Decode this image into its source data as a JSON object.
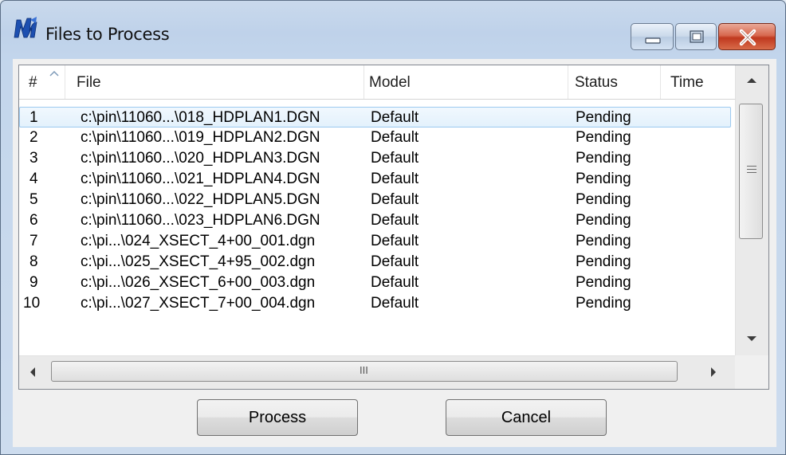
{
  "window": {
    "title": "Files to Process",
    "icon": "microstation-app-icon"
  },
  "window_controls": {
    "minimize_icon": "minimize-icon",
    "maximize_icon": "maximize-icon",
    "close_icon": "close-icon"
  },
  "columns": [
    "#",
    "File",
    "Model",
    "Status",
    "Time"
  ],
  "sort_column": "#",
  "rows": [
    {
      "num": "1",
      "file": "c:\\pin\\11060...\\018_HDPLAN1.DGN",
      "model": "Default",
      "status": "Pending",
      "time": ""
    },
    {
      "num": "2",
      "file": "c:\\pin\\11060...\\019_HDPLAN2.DGN",
      "model": "Default",
      "status": "Pending",
      "time": ""
    },
    {
      "num": "3",
      "file": "c:\\pin\\11060...\\020_HDPLAN3.DGN",
      "model": "Default",
      "status": "Pending",
      "time": ""
    },
    {
      "num": "4",
      "file": "c:\\pin\\11060...\\021_HDPLAN4.DGN",
      "model": "Default",
      "status": "Pending",
      "time": ""
    },
    {
      "num": "5",
      "file": "c:\\pin\\11060...\\022_HDPLAN5.DGN",
      "model": "Default",
      "status": "Pending",
      "time": ""
    },
    {
      "num": "6",
      "file": "c:\\pin\\11060...\\023_HDPLAN6.DGN",
      "model": "Default",
      "status": "Pending",
      "time": ""
    },
    {
      "num": "7",
      "file": "c:\\pi...\\024_XSECT_4+00_001.dgn",
      "model": "Default",
      "status": "Pending",
      "time": ""
    },
    {
      "num": "8",
      "file": "c:\\pi...\\025_XSECT_4+95_002.dgn",
      "model": "Default",
      "status": "Pending",
      "time": ""
    },
    {
      "num": "9",
      "file": "c:\\pi...\\026_XSECT_6+00_003.dgn",
      "model": "Default",
      "status": "Pending",
      "time": ""
    },
    {
      "num": "10",
      "file": "c:\\pi...\\027_XSECT_7+00_004.dgn",
      "model": "Default",
      "status": "Pending",
      "time": ""
    }
  ],
  "selected_row": 1,
  "buttons": {
    "process": "Process",
    "cancel": "Cancel"
  },
  "scrollbar": {
    "h_grip": "III"
  },
  "colors": {
    "selection_border": "#9cc9ef",
    "close_button": "#c0391f"
  }
}
